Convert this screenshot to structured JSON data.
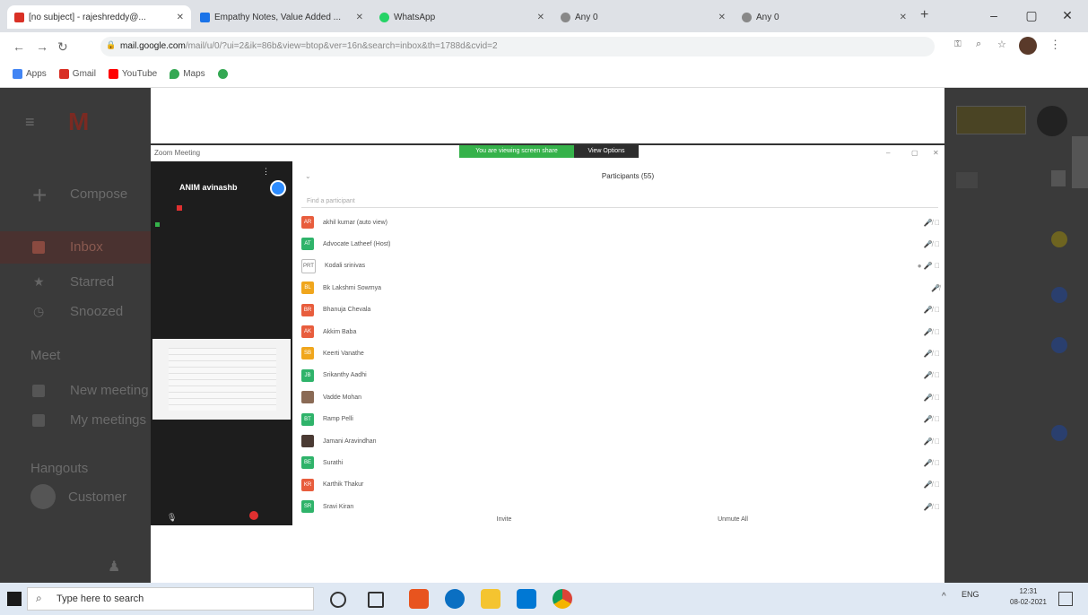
{
  "tabs": [
    {
      "title": "[no subject] - rajeshreddy@...",
      "active": true
    },
    {
      "title": "Empathy Notes, Value Added ...",
      "active": false
    },
    {
      "title": "WhatsApp",
      "active": false
    },
    {
      "title": "Any 0",
      "active": false
    },
    {
      "title": "Any 0",
      "active": false
    }
  ],
  "address": {
    "host": "mail.google.com",
    "path": "/mail/u/0/?ui=2&ik=86b&view=btop&ver=16n&search=inbox&th=1788d&cvid=2"
  },
  "bookmarks": [
    "Apps",
    "Gmail",
    "YouTube",
    "Maps"
  ],
  "gmail": {
    "compose": "Compose",
    "nav": [
      "Inbox",
      "Starred",
      "Snoozed"
    ],
    "meet": "Meet",
    "meet_items": [
      "New meeting",
      "My meetings"
    ],
    "hangouts": "Hangouts",
    "contact": "Customer"
  },
  "zoom": {
    "window_title": "Zoom Meeting",
    "green_banner": "You are viewing screen share",
    "view_options": "View Options",
    "self_name": "ANIM avinashb",
    "participants_title": "Participants (55)",
    "search_placeholder": "Find a participant",
    "invite": "Invite",
    "mute_all": "Unmute All",
    "participants": [
      {
        "initials": "AR",
        "name": "akhil kumar (auto view)",
        "color": "#e85d3d",
        "status": "🎤̸ ⃠"
      },
      {
        "initials": "AT",
        "name": "Advocate Latheef (Host)",
        "color": "#2fb36a",
        "status": "🎤̸ ⃠"
      },
      {
        "initials": "PRT",
        "name": "Kodali srinivas",
        "color": "#ffffff",
        "status": "● 🎤 ⃠"
      },
      {
        "initials": "BL",
        "name": "Bk Lakshmi Sowmya",
        "color": "#f0a61d",
        "status": "🎤̸"
      },
      {
        "initials": "BR",
        "name": "Bhanuja Chevala",
        "color": "#e85d3d",
        "status": "🎤̸ ⃠"
      },
      {
        "initials": "AK",
        "name": "Akkim Baba",
        "color": "#e85d3d",
        "status": "🎤̸ ⃠"
      },
      {
        "initials": "SB",
        "name": "Keerti Vanathe",
        "color": "#f0a61d",
        "status": "🎤̸ ⃠"
      },
      {
        "initials": "JB",
        "name": "Srikanthy Aadhi",
        "color": "#2fb36a",
        "status": "🎤̸ ⃠"
      },
      {
        "initials": "",
        "name": "Vadde Mohan",
        "color": "#8a6a55",
        "status": "🎤̸ ⃠"
      },
      {
        "initials": "BT",
        "name": "Ramp Pelli",
        "color": "#2fb36a",
        "status": "🎤̸ ⃠"
      },
      {
        "initials": "",
        "name": "Jamani Aravindhan",
        "color": "#4a3a33",
        "status": "🎤̸ ⃠"
      },
      {
        "initials": "BE",
        "name": "Surathi",
        "color": "#2fb36a",
        "status": "🎤̸ ⃠"
      },
      {
        "initials": "KR",
        "name": "Karthik Thakur",
        "color": "#e85d3d",
        "status": "🎤̸ ⃠"
      },
      {
        "initials": "SR",
        "name": "Sravi Kiran",
        "color": "#2fb36a",
        "status": "🎤̸ ⃠"
      }
    ]
  },
  "taskbar": {
    "search_placeholder": "Type here to search",
    "lang": "ENG",
    "time": "12:31",
    "date": "08-02-2021"
  }
}
